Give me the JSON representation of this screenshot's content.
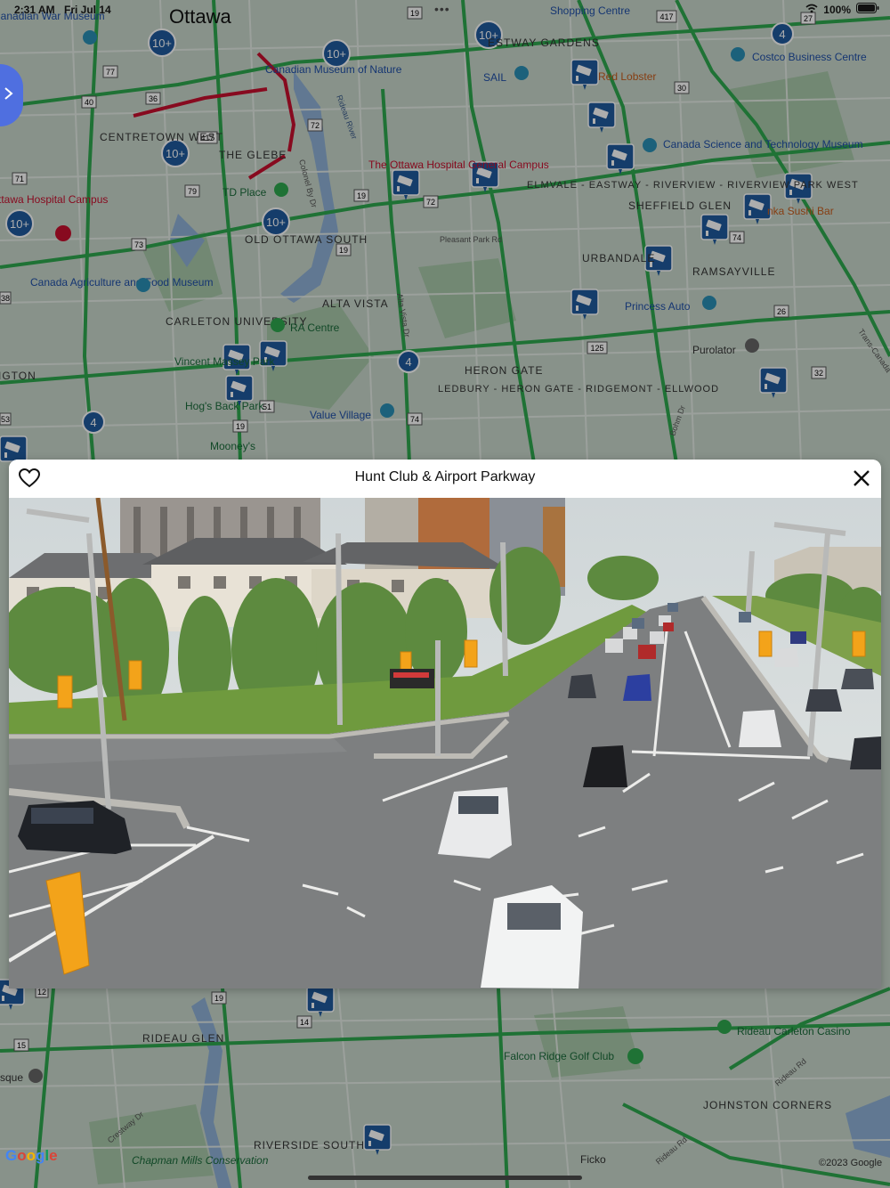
{
  "status_bar": {
    "time": "2:31 AM",
    "date": "Fri Jul 14",
    "battery": "100%"
  },
  "map": {
    "labels": {
      "ottawa": "Ottawa",
      "war_museum": "Canadian War Museum",
      "shopping": "Shopping Centre",
      "costco": "Costco Business Centre",
      "museum_nature": "Canadian Museum of Nature",
      "gardens": "ESTWAY GARDENS",
      "sail": "SAIL",
      "red_lobster": "Red Lobster",
      "centretown": "CENTRETOWN WEST",
      "glebe": "THE GLEBE",
      "science_museum": "Canada Science and Technology Museum",
      "ottawa_hospital": "The Ottawa Hospital General Campus",
      "hospital_civic": "ttawa Hospital Campus",
      "td_place": "TD Place",
      "elmvale": "ELMVALE - EASTWAY - RIVERVIEW - RIVERVIEW PARK WEST",
      "sheffield": "SHEFFIELD GLEN",
      "sushi": "nka Sushi Bar",
      "old_ottawa": "OLD OTTAWA SOUTH",
      "pleasant_park": "Pleasant Park Rd",
      "urbandale": "URBANDALE",
      "ramsayville": "RAMSAYVILLE",
      "agri_museum": "Canada Agriculture and Food Museum",
      "alta_vista": "ALTA VISTA",
      "princess_auto": "Princess Auto",
      "carleton": "CARLETON UNIVERSITY",
      "ra_centre": "RA Centre",
      "purolator": "Purolator",
      "vincent_massey": "Vincent Massey Park",
      "heron_gate": "HERON GATE",
      "ington": "IGTON",
      "ledbury": "LEDBURY - HERON GATE - RIDGEMONT - ELLWOOD",
      "hogs_back": "Hog's Back Park",
      "value_village": "Value Village",
      "mooneys": "Mooney's",
      "rideau_glen": "RIDEAU GLEN",
      "rideau_casino": "Rideau Carleton Casino",
      "falcon_ridge": "Falcon Ridge Golf Club",
      "johnston": "JOHNSTON CORNERS",
      "riverside": "RIVERSIDE SOUTH",
      "chapman": "Chapman Mills Conservation",
      "ficko": "Ficko",
      "google": "Google",
      "copyright": "©2023 Google",
      "rideau_river": "Rideau River",
      "colonel_by": "Colonel By Dr",
      "alta_vista_dr": "Alta Vista Dr",
      "bohm_dr": "Bohm Dr",
      "trans_canada": "Trans-Canada",
      "rideau_rd": "Rideau Rd",
      "crestway": "Crestway Dr",
      "sque": "sque"
    },
    "clusters": {
      "ten_plus": "10+",
      "four": "4"
    },
    "shields": {
      "s19": "19",
      "s417": "417",
      "s27": "27",
      "s77": "77",
      "s36": "36",
      "s40": "40",
      "s30": "30",
      "s72": "72",
      "s71": "71",
      "s79": "79",
      "s74": "74",
      "s73": "73",
      "s38": "38",
      "s26": "26",
      "s125": "125",
      "s51": "51",
      "s32": "32",
      "s53": "53",
      "s14": "14",
      "s15": "15",
      "s12": "12"
    }
  },
  "camera_card": {
    "title": "Hunt Club & Airport Parkway",
    "favorite_icon": "heart-icon",
    "close_icon": "close-icon"
  },
  "colors": {
    "map_bg": "#c9d8cc",
    "road_green": "#2fa84f",
    "road_red": "#c8102e",
    "camera_marker": "#1f5a9e",
    "cluster": "#1f5a9e",
    "accent_blue": "#4f6fe0"
  }
}
